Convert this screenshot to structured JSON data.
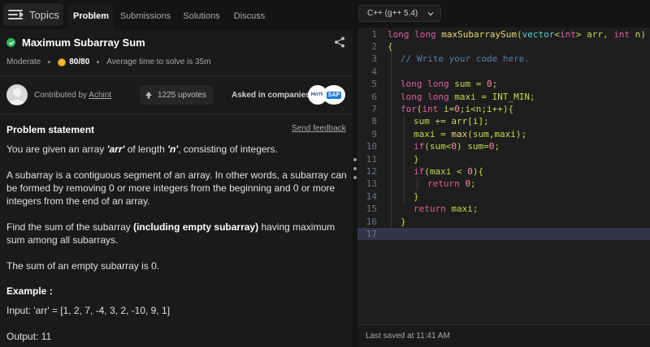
{
  "tabs": {
    "topics": "Topics",
    "problem": "Problem",
    "submissions": "Submissions",
    "solutions": "Solutions",
    "discuss": "Discuss"
  },
  "problem": {
    "title": "Maximum Subarray Sum",
    "difficulty": "Moderate",
    "score": "80/80",
    "avg_time": "Average time to solve is 35m",
    "contributed_by_label": "Contributed by",
    "contributor": "Achint",
    "upvotes": "1225 upvotes",
    "asked_in_label": "Asked in companies",
    "companies": [
      "PAYTM",
      "SAP"
    ],
    "statement_heading": "Problem statement",
    "send_feedback": "Send feedback",
    "p1_a": "You are given an array ",
    "p1_arr": "'arr'",
    "p1_b": " of length ",
    "p1_n": "'n'",
    "p1_c": ", consisting of integers.",
    "p2": "A subarray is a contiguous segment of an array. In other words, a subarray can be formed by removing 0 or more integers from the beginning and 0 or more integers from the end of an array.",
    "p3_a": "Find the sum of the subarray ",
    "p3_b": "(including empty subarray)",
    "p3_c": " having maximum sum among all subarrays.",
    "p4": "The sum of an empty subarray is 0.",
    "example_heading": "Example :",
    "input": "Input: 'arr' = [1, 2, 7, -4, 3, 2, -10, 9, 1]",
    "output": "Output: 11"
  },
  "editor": {
    "language": "C++ (g++ 5.4)",
    "last_saved": "Last saved at 11:41 AM",
    "current_line": 17,
    "line_numbers": [
      "1",
      "2",
      "3",
      "4",
      "5",
      "6",
      "7",
      "8",
      "9",
      "10",
      "11",
      "12",
      "13",
      "14",
      "15",
      "16",
      "17"
    ],
    "code": {
      "l1_kw": "long long ",
      "l1_fn": "maxSubarraySum",
      "l1_p1": "(",
      "l1_ty": "vector",
      "l1_p2": "<",
      "l1_kw2": "int",
      "l1_p3": "> arr, ",
      "l1_kw3": "int",
      "l1_p4": " n)",
      "l2": "{",
      "l3": "// Write your code here.",
      "l5_kw": "long long ",
      "l5_p": "sum = ",
      "l5_n": "0",
      "l5_e": ";",
      "l6_kw": "long long ",
      "l6_p": "maxi = INT_MIN;",
      "l7_kw": "for",
      "l7_p1": "(",
      "l7_kw2": "int ",
      "l7_p2": "i=",
      "l7_n": "0",
      "l7_p3": ";i<n;i++){",
      "l8_p": "sum += arr[i];",
      "l9_p1": "maxi = ",
      "l9_fn": "max",
      "l9_p2": "(sum,maxi);",
      "l10_kw": "if",
      "l10_p1": "(sum<",
      "l10_n": "0",
      "l10_p2": ") sum=",
      "l10_n2": "0",
      "l10_p3": ";",
      "l11": "}",
      "l12_kw": "if",
      "l12_p1": "(maxi < ",
      "l12_n": "0",
      "l12_p2": "){",
      "l13_kw": "return ",
      "l13_n": "0",
      "l13_p": ";",
      "l14": "}",
      "l15_kw": "return ",
      "l15_p": "maxi;",
      "l16": "}"
    }
  },
  "colors": {
    "accent_check": "#2db55d",
    "coin": "#f5b92b",
    "keyword": "#e0609c",
    "function": "#e8d774",
    "number": "#ff8aa0",
    "comment": "#5c7fa8",
    "type": "#5bd1d7",
    "plain": "#c8d84e"
  },
  "icons": [
    "hamburger-icon",
    "check-circle-icon",
    "share-icon",
    "coin-icon",
    "avatar-icon",
    "upvote-arrow-icon",
    "chevron-down-icon"
  ]
}
